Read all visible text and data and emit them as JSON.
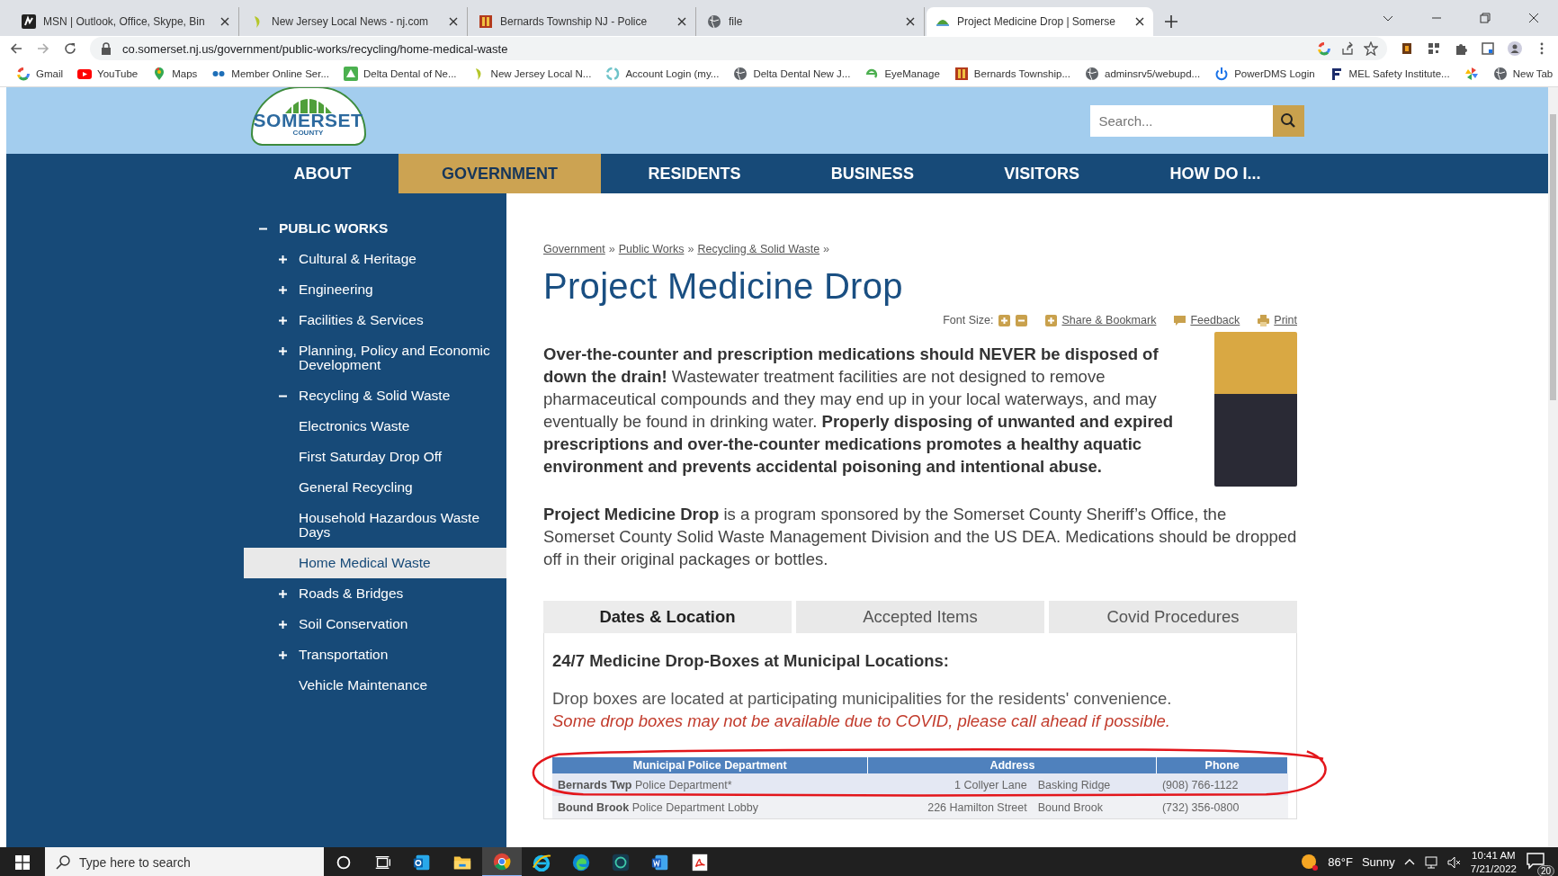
{
  "browser": {
    "tabs": [
      {
        "title": "MSN | Outlook, Office, Skype, Bin",
        "kind": "msn",
        "selected": false
      },
      {
        "title": "New Jersey Local News - nj.com",
        "kind": "leaf",
        "selected": false
      },
      {
        "title": "Bernards Township NJ - Police",
        "kind": "crest",
        "selected": false
      },
      {
        "title": "file",
        "kind": "globe",
        "selected": false
      },
      {
        "title": "Project Medicine Drop | Somerse",
        "kind": "dome",
        "selected": true
      }
    ],
    "address": "co.somerset.nj.us/government/public-works/recycling/home-medical-waste",
    "bookmarks": [
      {
        "label": "Gmail",
        "kind": "google"
      },
      {
        "label": "YouTube",
        "kind": "youtube"
      },
      {
        "label": "Maps",
        "kind": "pin"
      },
      {
        "label": "Member Online Ser...",
        "kind": "glasses"
      },
      {
        "label": "Delta Dental of Ne...",
        "kind": "triangle"
      },
      {
        "label": "New Jersey Local N...",
        "kind": "leaf"
      },
      {
        "label": "Account Login (my...",
        "kind": "ring"
      },
      {
        "label": "Delta Dental New J...",
        "kind": "globe"
      },
      {
        "label": "EyeManage",
        "kind": "eye"
      },
      {
        "label": "Bernards Township...",
        "kind": "crest"
      },
      {
        "label": "adminsrv5/webupd...",
        "kind": "globe"
      },
      {
        "label": "PowerDMS Login",
        "kind": "power"
      },
      {
        "label": "MEL Safety Institute...",
        "kind": "flag"
      },
      {
        "kind": "pinwheel"
      },
      {
        "label": "New Tab",
        "kind": "globe"
      }
    ]
  },
  "site": {
    "logo": {
      "name": "SOMERSET",
      "sub": "COUNTY"
    },
    "search": {
      "placeholder": "Search..."
    },
    "nav": [
      {
        "label": "ABOUT",
        "selected": false
      },
      {
        "label": "GOVERNMENT",
        "selected": true
      },
      {
        "label": "RESIDENTS",
        "selected": false
      },
      {
        "label": "BUSINESS",
        "selected": false
      },
      {
        "label": "VISITORS",
        "selected": false
      },
      {
        "label": "HOW DO I...",
        "selected": false
      }
    ],
    "sidebar": [
      {
        "label": "PUBLIC WORKS",
        "kind": "toggle",
        "expanded": true,
        "selected": false,
        "children": [
          {
            "label": "Cultural & Heritage",
            "kind": "toggle",
            "expanded": false,
            "selected": false
          },
          {
            "label": "Engineering",
            "kind": "toggle",
            "expanded": false,
            "selected": false
          },
          {
            "label": "Facilities & Services",
            "kind": "toggle",
            "expanded": false,
            "selected": false
          },
          {
            "label": "Planning, Policy and Economic Development",
            "kind": "toggle",
            "expanded": false,
            "selected": false
          },
          {
            "label": "Recycling & Solid Waste",
            "kind": "toggle",
            "expanded": true,
            "selected": false,
            "children": [
              {
                "label": "Electronics Waste",
                "kind": "leaf",
                "selected": false
              },
              {
                "label": "First Saturday Drop Off",
                "kind": "leaf",
                "selected": false
              },
              {
                "label": "General Recycling",
                "kind": "leaf",
                "selected": false
              },
              {
                "label": "Household Hazardous Waste Days",
                "kind": "leaf",
                "selected": false
              },
              {
                "label": "Home Medical Waste",
                "kind": "leaf",
                "selected": true
              }
            ]
          },
          {
            "label": "Roads & Bridges",
            "kind": "toggle",
            "expanded": false,
            "selected": false
          },
          {
            "label": "Soil Conservation",
            "kind": "toggle",
            "expanded": false,
            "selected": false
          },
          {
            "label": "Transportation",
            "kind": "toggle",
            "expanded": false,
            "selected": false
          },
          {
            "label": "Vehicle Maintenance",
            "kind": "leaf",
            "selected": false
          }
        ]
      }
    ],
    "breadcrumb": [
      {
        "label": "Government",
        "separator": "»"
      },
      {
        "label": "Public Works",
        "separator": "»"
      },
      {
        "label": "Recycling & Solid Waste",
        "separator": "»"
      }
    ],
    "title": "Project Medicine Drop",
    "tools": {
      "font_size_label": "Font Size:",
      "links": [
        {
          "label": "Share & Bookmark",
          "kind": "plus"
        },
        {
          "label": "Feedback",
          "kind": "comment"
        },
        {
          "label": "Print",
          "kind": "printer"
        }
      ]
    },
    "intro": [
      "**Over-the-counter and prescription medications should NEVER be disposed of down the drain!** Wastewater treatment facilities are not designed to remove pharmaceutical compounds and they may end up in your local waterways, and may eventually be found in drinking water. **Properly disposing of unwanted and expired prescriptions and over-the-counter medications promotes a healthy aquatic environment and prevents accidental poisoning and intentional abuse.**",
      "**Project Medicine Drop** is a program sponsored by the Somerset County Sheriff’s Office, the Somerset County Solid Waste Management Division and the US DEA. Medications should be dropped off in their original packages or bottles."
    ],
    "tabs": [
      {
        "label": "Dates & Location",
        "selected": true
      },
      {
        "label": "Accepted Items",
        "selected": false
      },
      {
        "label": "Covid Procedures",
        "selected": false
      }
    ],
    "panel": {
      "heading": "24/7 Medicine Drop-Boxes at Municipal Locations:",
      "text": "Drop boxes are located at participating municipalities for the residents' convenience.",
      "notice": "Some drop boxes may not be available due to COVID, please call ahead if possible."
    },
    "table": {
      "columns": [
        "Municipal Police Department",
        "Address",
        "Phone"
      ],
      "rows": [
        {
          "department": "**Bernards Twp** Police Department*",
          "street": "1 Collyer Lane",
          "town": "Basking Ridge",
          "phone": "(908) 766-1122"
        },
        {
          "department": "**Bound Brook** Police Department Lobby",
          "street": "226 Hamilton Street",
          "town": "Bound Brook",
          "phone": "(732) 356-0800"
        }
      ]
    }
  },
  "taskbar": {
    "search_placeholder": "Type here to search",
    "apps": [
      {
        "kind": "outlook",
        "selected": false
      },
      {
        "kind": "folder",
        "selected": false
      },
      {
        "kind": "chrome",
        "selected": true
      },
      {
        "kind": "ie",
        "selected": false
      },
      {
        "kind": "edge",
        "selected": false
      },
      {
        "kind": "app",
        "selected": false
      },
      {
        "kind": "word",
        "selected": false
      },
      {
        "kind": "pdf",
        "selected": false
      }
    ],
    "weather": {
      "temperature": "86°F",
      "condition": "Sunny"
    },
    "time": "10:41 AM",
    "date": "7/21/2022",
    "notifications": "20"
  }
}
